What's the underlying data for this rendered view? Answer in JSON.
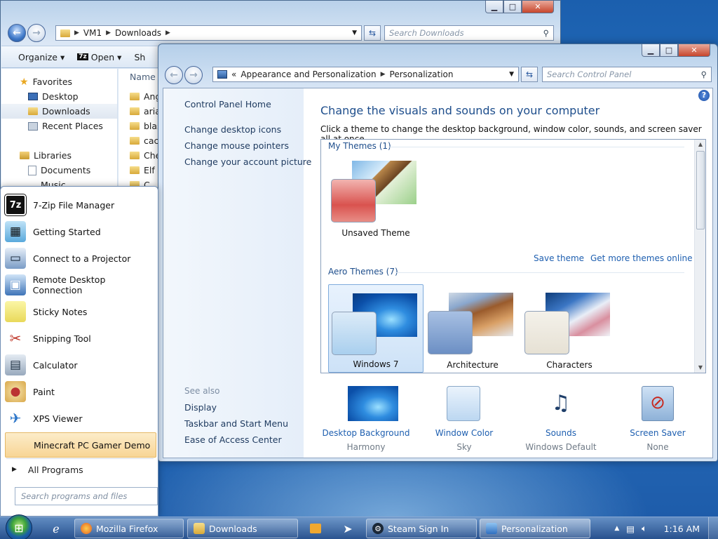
{
  "explorer": {
    "address": [
      "VM1",
      "Downloads"
    ],
    "search_placeholder": "Search Downloads",
    "toolbar": {
      "organize": "Organize",
      "open": "Open",
      "share": "Sh"
    },
    "nav": {
      "favorites": "Favorites",
      "desktop": "Desktop",
      "downloads": "Downloads",
      "recent": "Recent Places",
      "libraries": "Libraries",
      "documents": "Documents",
      "music": "Music"
    },
    "column_name": "Name",
    "files": [
      "Ang",
      "aria",
      "blas",
      "cac",
      "Che",
      "Elf",
      "C"
    ]
  },
  "control_panel": {
    "address_prefix": "«",
    "address": [
      "Appearance and Personalization",
      "Personalization"
    ],
    "search_placeholder": "Search Control Panel",
    "help": "?",
    "left": {
      "home": "Control Panel Home",
      "links": [
        "Change desktop icons",
        "Change mouse pointers",
        "Change your account picture"
      ],
      "see_also": "See also",
      "see_also_links": [
        "Display",
        "Taskbar and Start Menu",
        "Ease of Access Center"
      ]
    },
    "title": "Change the visuals and sounds on your computer",
    "subtitle": "Click a theme to change the desktop background, window color, sounds, and screen saver all at once.",
    "my_themes": {
      "header": "My Themes (1)",
      "themes": [
        {
          "name": "Unsaved Theme",
          "swatch": "#d9534f"
        }
      ]
    },
    "save_theme": "Save theme",
    "get_more": "Get more themes online",
    "aero_themes": {
      "header": "Aero Themes (7)",
      "themes": [
        {
          "name": "Windows 7",
          "swatch": "#a9cfee"
        },
        {
          "name": "Architecture",
          "swatch": "#6c8fc4"
        },
        {
          "name": "Characters",
          "swatch": "#e6e1d4"
        }
      ]
    },
    "bottom": [
      {
        "label": "Desktop Background",
        "value": "Harmony",
        "icon": "desktop-background-icon"
      },
      {
        "label": "Window Color",
        "value": "Sky",
        "icon": "window-color-icon"
      },
      {
        "label": "Sounds",
        "value": "Windows Default",
        "icon": "sounds-icon"
      },
      {
        "label": "Screen Saver",
        "value": "None",
        "icon": "screen-saver-icon"
      }
    ]
  },
  "start_menu": {
    "items": [
      {
        "label": "7-Zip File Manager",
        "icon": "7zip-icon"
      },
      {
        "label": "Getting Started",
        "icon": "getting-started-icon"
      },
      {
        "label": "Connect to a Projector",
        "icon": "projector-icon"
      },
      {
        "label": "Remote Desktop Connection",
        "icon": "remote-desktop-icon"
      },
      {
        "label": "Sticky Notes",
        "icon": "sticky-notes-icon"
      },
      {
        "label": "Snipping Tool",
        "icon": "snipping-tool-icon"
      },
      {
        "label": "Calculator",
        "icon": "calculator-icon"
      },
      {
        "label": "Paint",
        "icon": "paint-icon"
      },
      {
        "label": "XPS Viewer",
        "icon": "xps-viewer-icon"
      },
      {
        "label": "Minecraft PC Gamer Demo",
        "icon": "minecraft-icon"
      }
    ],
    "all_programs": "All Programs",
    "search_placeholder": "Search programs and files"
  },
  "taskbar": {
    "buttons": [
      {
        "label": "Mozilla Firefox",
        "icon": "firefox-icon"
      },
      {
        "label": "Downloads",
        "icon": "folder-icon"
      },
      {
        "label": "Steam Sign In",
        "icon": "steam-icon"
      },
      {
        "label": "Personalization",
        "icon": "personalization-icon"
      }
    ],
    "clock": "1:16 AM"
  }
}
